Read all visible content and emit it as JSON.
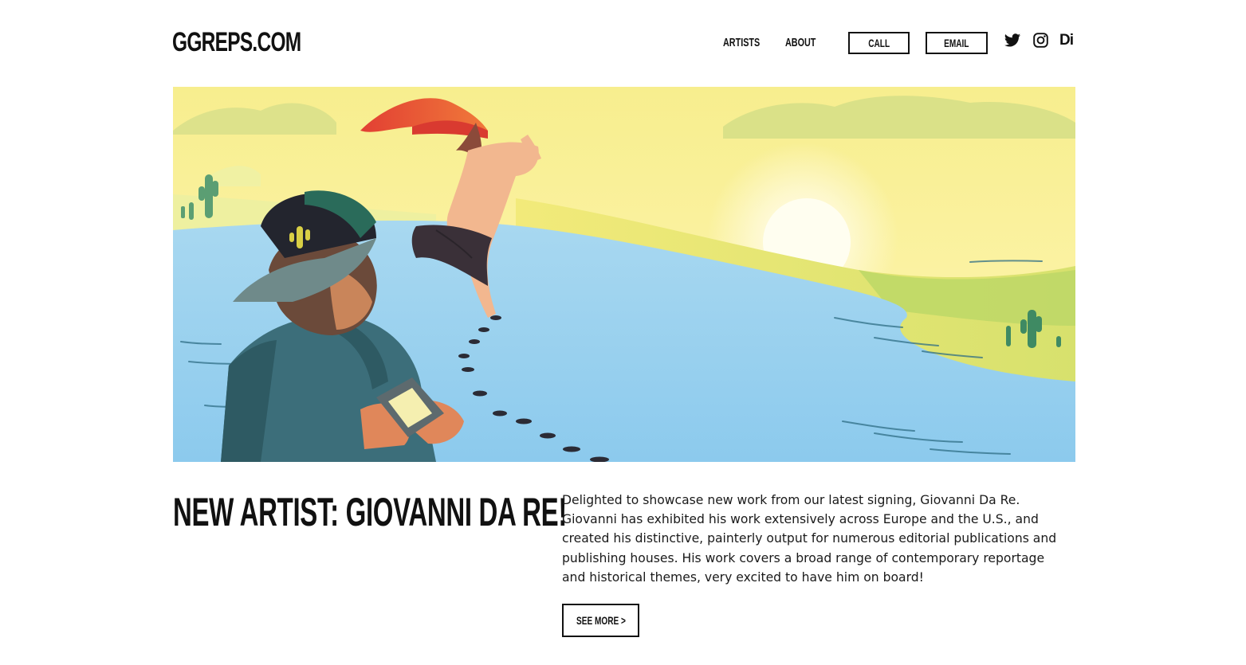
{
  "header": {
    "logo": "GGREPS.COM",
    "nav": {
      "artists": "ARTISTS",
      "about": "ABOUT",
      "call": "CALL",
      "email": "EMAIL"
    },
    "social": [
      "twitter-icon",
      "instagram-icon",
      "directory-icon"
    ],
    "directory_mark": "Di"
  },
  "hero": {
    "image": "illustration of a man in a cap holding a camera looking at a woman with a red scarf walking over a blue lake toward a setting sun, yellow sky, cactus on shores"
  },
  "article": {
    "headline": "NEW ARTIST: GIOVANNI DA RE!",
    "body": "Delighted to showcase new work from our latest signing, Giovanni Da Re. Giovanni has exhibited his work extensively across Europe and the U.S., and created his distinctive, painterly output for numerous editorial publications and publishing houses. His work covers a broad range of contemporary reportage and historical themes, very excited to have him on board!",
    "cta": "SEE MORE >"
  },
  "colors": {
    "sky": "#fbf19c",
    "lake": "#9fd3ef",
    "scarf": "#e8503a",
    "text": "#111111"
  }
}
